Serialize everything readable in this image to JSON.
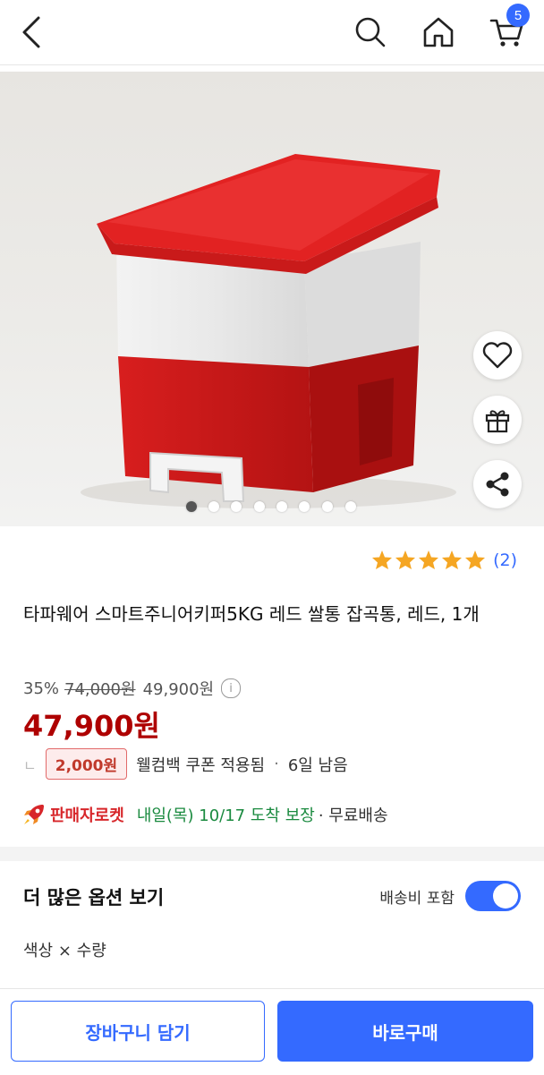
{
  "header": {
    "icons": [
      "back-icon",
      "search-icon",
      "home-icon",
      "cart-icon"
    ],
    "cart_count": "5"
  },
  "hero": {
    "side_icons": [
      "heart-icon",
      "gift-icon",
      "share-icon"
    ],
    "image_count": 8,
    "active_index": 0
  },
  "rating": {
    "stars": 5,
    "count_label": "(2)"
  },
  "product": {
    "title": "타파웨어 스마트주니어키퍼5KG 레드 쌀통 잡곡통, 레드, 1개"
  },
  "pricing": {
    "discount": "35%",
    "original": "74,000원",
    "sale": "49,900원",
    "info_glyph": "i",
    "final": "47,900원"
  },
  "coupon": {
    "hook": "ㄴ",
    "amount": "2,000원",
    "text": "웰컴백 쿠폰 적용됨",
    "sep": "·",
    "remaining": "6일 남음"
  },
  "delivery": {
    "badge": "판매자로켓",
    "text": "내일(목) 10/17 도착 보장",
    "extra": "· 무료배송"
  },
  "options": {
    "title": "더 많은 옵션 보기",
    "shipping_label": "배송비 포함",
    "shipping_included": true,
    "subtitle": "색상 × 수량"
  },
  "actions": {
    "cart": "장바구니 담기",
    "buy": "바로구매"
  },
  "colors": {
    "accent": "#346aff",
    "price_red": "#ae0000",
    "star": "#f5a623",
    "delivery_green": "#1a8a3f"
  }
}
